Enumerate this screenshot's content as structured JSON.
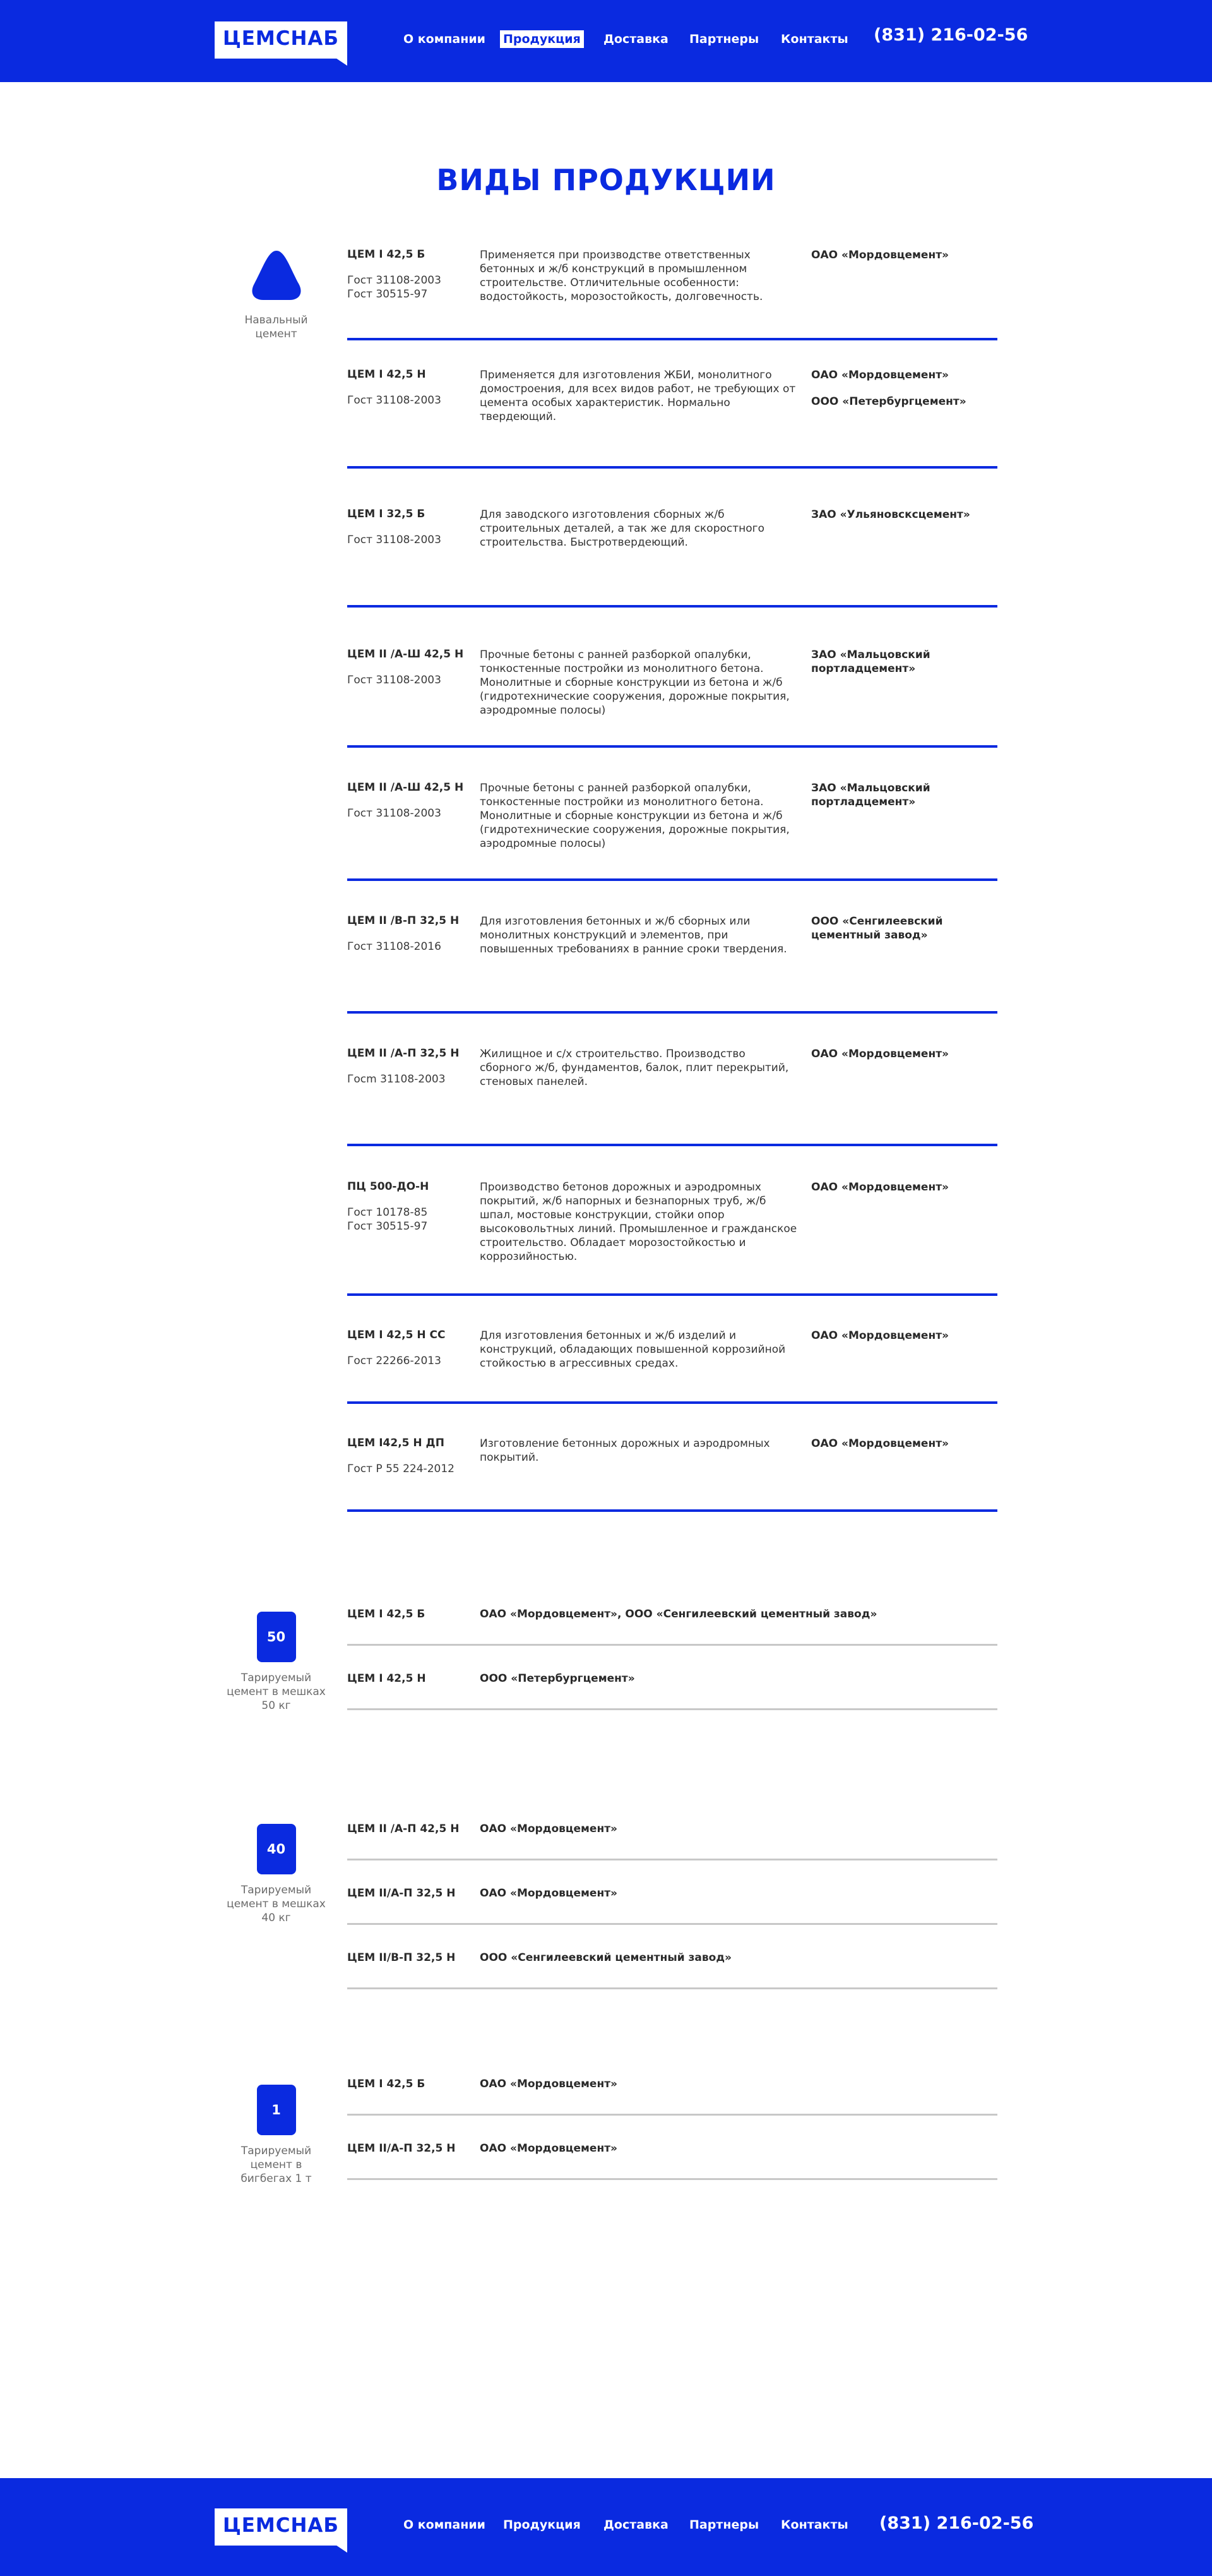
{
  "brand": {
    "logo_text": "ЦЕМСНАБ",
    "accent": "#0a2ae0"
  },
  "nav": [
    {
      "label": "О компании",
      "active": false
    },
    {
      "label": "Продукция",
      "active": true
    },
    {
      "label": "Доставка",
      "active": false
    },
    {
      "label": "Партнеры",
      "active": false
    },
    {
      "label": "Контакты",
      "active": false
    }
  ],
  "phone": "(831) 216-02-56",
  "page_title": "ВИДЫ ПРОДУКЦИИ",
  "bulk": {
    "label": "Навальный цемент",
    "icon": "cement-pile-icon",
    "items": [
      {
        "name": "ЦЕМ I 42,5 Б",
        "gost": "Гост 31108-2003\nГост 30515-97",
        "desc": "Применяется при производстве ответственных бетонных и ж/б конструкций в промышленном строительстве. Отличительные особенности: водостойкость, морозостойкость, долговечность.",
        "makers": [
          "ОАО «Мордовцемент»"
        ]
      },
      {
        "name": "ЦЕМ I 42,5 Н",
        "gost": "Гост 31108-2003",
        "desc": "Применяется для изготовления ЖБИ, монолитного домостроения, для всех  видов работ, не требующих от цемента особых характеристик. Нормально твердеющий.",
        "makers": [
          "ОАО «Мордовцемент»",
          "ООО «Петербургцемент»"
        ]
      },
      {
        "name": "ЦЕМ I 32,5 Б",
        "gost": "Гост 31108-2003",
        "desc": "Для заводского изготовления сборных ж/б строительных деталей, а так же для скоростного строительства. Быстротвердеющий.",
        "makers": [
          "ЗАО «Ульяновсксцемент»"
        ]
      },
      {
        "name": "ЦЕМ II /А-Ш 42,5 Н",
        "gost": "Гост 31108-2003",
        "desc": "Прочные бетоны с ранней разборкой опалубки, тонкостенные постройки из монолитного бетона. Монолитные и сборные конструкции из бетона и ж/б  (гидротехнические сооружения, дорожные покрытия, аэродромные полосы)",
        "makers": [
          "ЗАО «Мальцовский портладцемент»"
        ]
      },
      {
        "name": "ЦЕМ II /А-Ш 42,5 Н",
        "gost": "Гост 31108-2003",
        "desc": "Прочные бетоны с ранней разборкой опалубки, тонкостенные постройки из монолитного бетона. Монолитные и сборные конструкции из бетона и ж/б  (гидротехнические сооружения, дорожные покрытия, аэродромные полосы)",
        "makers": [
          "ЗАО «Мальцовский портладцемент»"
        ]
      },
      {
        "name": "ЦЕМ II /В-П 32,5 Н",
        "gost": "Гост 31108-2016",
        "desc": "Для изготовления бетонных и ж/б сборных или монолитных конструкций и элементов, при повышенных требованиях в ранние сроки твердения.",
        "makers": [
          "ООО «Сенгилеевский цементный завод»"
        ]
      },
      {
        "name": "ЦЕМ II /А-П 32,5 Н",
        "gost": "Госm 31108-2003",
        "desc": "Жилищное и с/х строительство. Производство сборного ж/б, фундаментов, балок, плит перекрытий, стеновых панелей.",
        "makers": [
          "ОАО «Мордовцемент»"
        ]
      },
      {
        "name": "ПЦ 500-ДО-Н",
        "gost": "Гост 10178-85\nГост 30515-97",
        "desc": "Производство бетонов дорожных и аэродромных покрытий, ж/б напорных  и безнапорных труб, ж/б шпал, мостовые конструкции, стойки опор высоковольтных линий. Промышленное и гражданское строительство. Обладает морозостойкостью и коррозийностью.",
        "makers": [
          "ОАО «Мордовцемент»"
        ]
      },
      {
        "name": "ЦЕМ I 42,5 Н СС",
        "gost": "Гост 22266-2013",
        "desc": "Для изготовления бетонных и ж/б изделий и конструкций, обладающих повышенной коррозийной стойкостью в агрессивных средах.",
        "makers": [
          "ОАО «Мордовцемент»"
        ]
      },
      {
        "name": "ЦЕМ I42,5 Н ДП",
        "gost": "Гост Р 55 224-2012",
        "desc": "Изготовление бетонных дорожных и аэродромных покрытий.",
        "makers": [
          "ОАО «Мордовцемент»"
        ]
      }
    ]
  },
  "packaged": [
    {
      "badge": "50",
      "label": "Тарируемый цемент в мешках 50 кг",
      "items": [
        {
          "name": "ЦЕМ I 42,5 Б",
          "maker": "ОАО «Мордовцемент», ООО «Сенгилеевский цементный завод»"
        },
        {
          "name": "ЦЕМ I 42,5 Н",
          "maker": "ООО «Петербургцемент»"
        }
      ]
    },
    {
      "badge": "40",
      "label": "Тарируемый цемент в мешках 40 кг",
      "items": [
        {
          "name": "ЦЕМ II /А-П 42,5 Н",
          "maker": "ОАО «Мордовцемент»"
        },
        {
          "name": "ЦЕМ II/А-П 32,5 Н",
          "maker": "ОАО «Мордовцемент»"
        },
        {
          "name": "ЦЕМ II/В-П 32,5 Н",
          "maker": "ООО «Сенгилеевский цементный завод»"
        }
      ]
    },
    {
      "badge": "1",
      "label": "Тарируемый цемент в бигбегах 1 т",
      "items": [
        {
          "name": "ЦЕМ I 42,5 Б",
          "maker": "ОАО «Мордовцемент»"
        },
        {
          "name": "ЦЕМ II/А-П 32,5 Н",
          "maker": "ОАО «Мордовцемент»"
        }
      ]
    }
  ]
}
